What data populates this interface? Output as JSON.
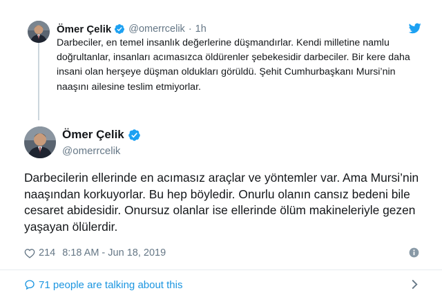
{
  "parent_tweet": {
    "name": "Ömer Çelik",
    "handle": "@omerrcelik",
    "separator": "·",
    "time": "1h",
    "text": "Darbeciler, en temel insanlık değerlerine düşmandırlar. Kendi milletine namlu doğrultanlar, insanları acımasızca öldürenler şebekesidir darbeciler. Bir kere daha insani olan herşeye düşman oldukları görüldü. Şehit Cumhurbaşkanı Mursi’nin naaşını ailesine teslim etmiyorlar.",
    "verified_icon": "verified-badge-icon",
    "brand_icon": "twitter-bird-icon"
  },
  "main_tweet": {
    "name": "Ömer Çelik",
    "handle": "@omerrcelik",
    "text": "Darbecilerin ellerinde en acımasız araçlar ve yöntemler var. Ama Mursi’nin naaşından korkuyorlar. Bu hep böyledir. Onurlu olanın cansız bedeni bile cesaret abidesidir. Onursuz olanlar ise ellerinde ölüm makineleriyle gezen yaşayan ölülerdir.",
    "likes": "214",
    "timestamp": "8:18 AM - Jun 18, 2019"
  },
  "footer": {
    "talking": "71 people are talking about this"
  },
  "colors": {
    "accent": "#1da1f2",
    "link": "#1b95e0",
    "muted": "#657786",
    "text": "#14171a",
    "divider": "#e6ecf0"
  }
}
